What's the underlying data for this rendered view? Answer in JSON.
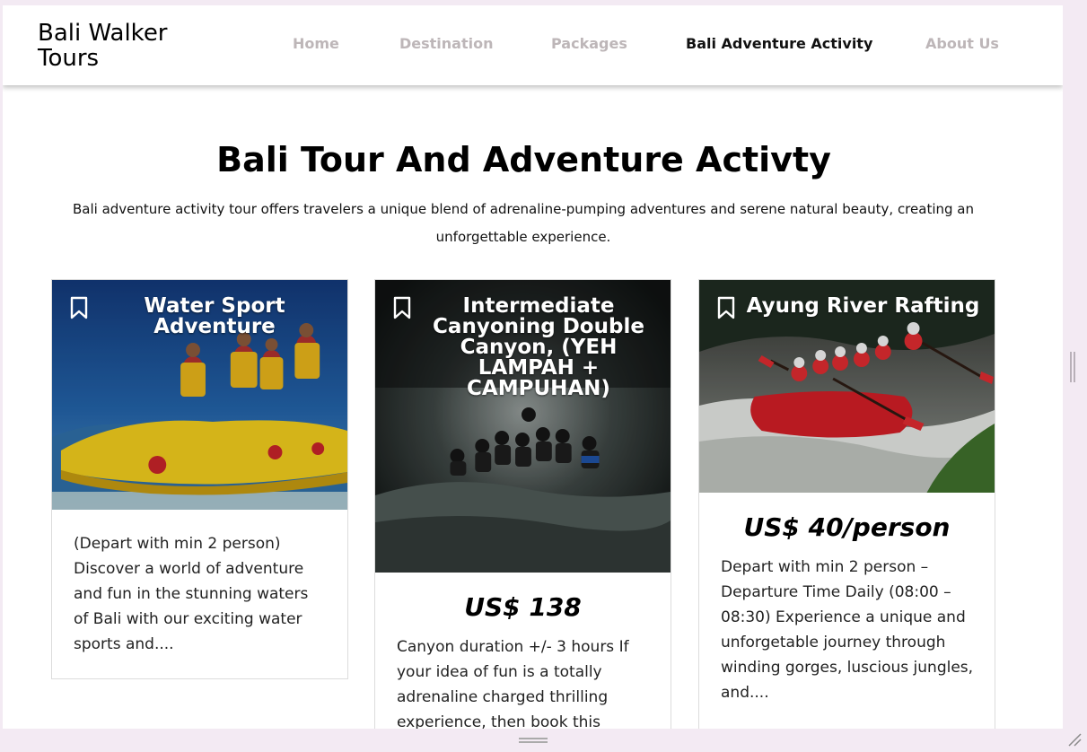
{
  "header": {
    "brand": "Bali Walker Tours",
    "nav": [
      {
        "label": "Home",
        "active": false
      },
      {
        "label": "Destination",
        "active": false
      },
      {
        "label": "Packages",
        "active": false
      },
      {
        "label": "Bali Adventure Activity",
        "active": true
      },
      {
        "label": "About Us",
        "active": false
      }
    ]
  },
  "main": {
    "title": "Bali Tour And Adventure Activty",
    "intro": "Bali adventure activity tour offers travelers a unique blend of adrenaline-pumping adventures and serene natural beauty, creating an unforgettable experience."
  },
  "cards": [
    {
      "title": "Water Sport Adventure",
      "price": "",
      "description": "(Depart with min 2 person) Discover a world of adventure and fun in the stunning waters of Bali with our exciting water sports and....",
      "image": "banana-boat-photo"
    },
    {
      "title": "Intermediate Canyoning Double Canyon, (YEH LAMPAH + CAMPUHAN)",
      "price": "US$ 138",
      "description": "Canyon duration +/- 3 hours If your idea of fun is a totally adrenaline charged thrilling experience, then book this",
      "image": "canyoning-waterfall-photo"
    },
    {
      "title": "Ayung River Rafting",
      "price": "US$ 40/person",
      "description": "Depart with min 2 person – Departure Time Daily (08:00 – 08:30) Experience a unique and unforgetable journey through winding gorges, luscious jungles, and....",
      "image": "river-rafting-photo"
    }
  ],
  "icons": {
    "bookmark": "bookmark-icon"
  },
  "colors": {
    "nav_inactive": "#bdb6b8",
    "nav_active": "#111111",
    "frame_background": "#f3eaf3"
  }
}
